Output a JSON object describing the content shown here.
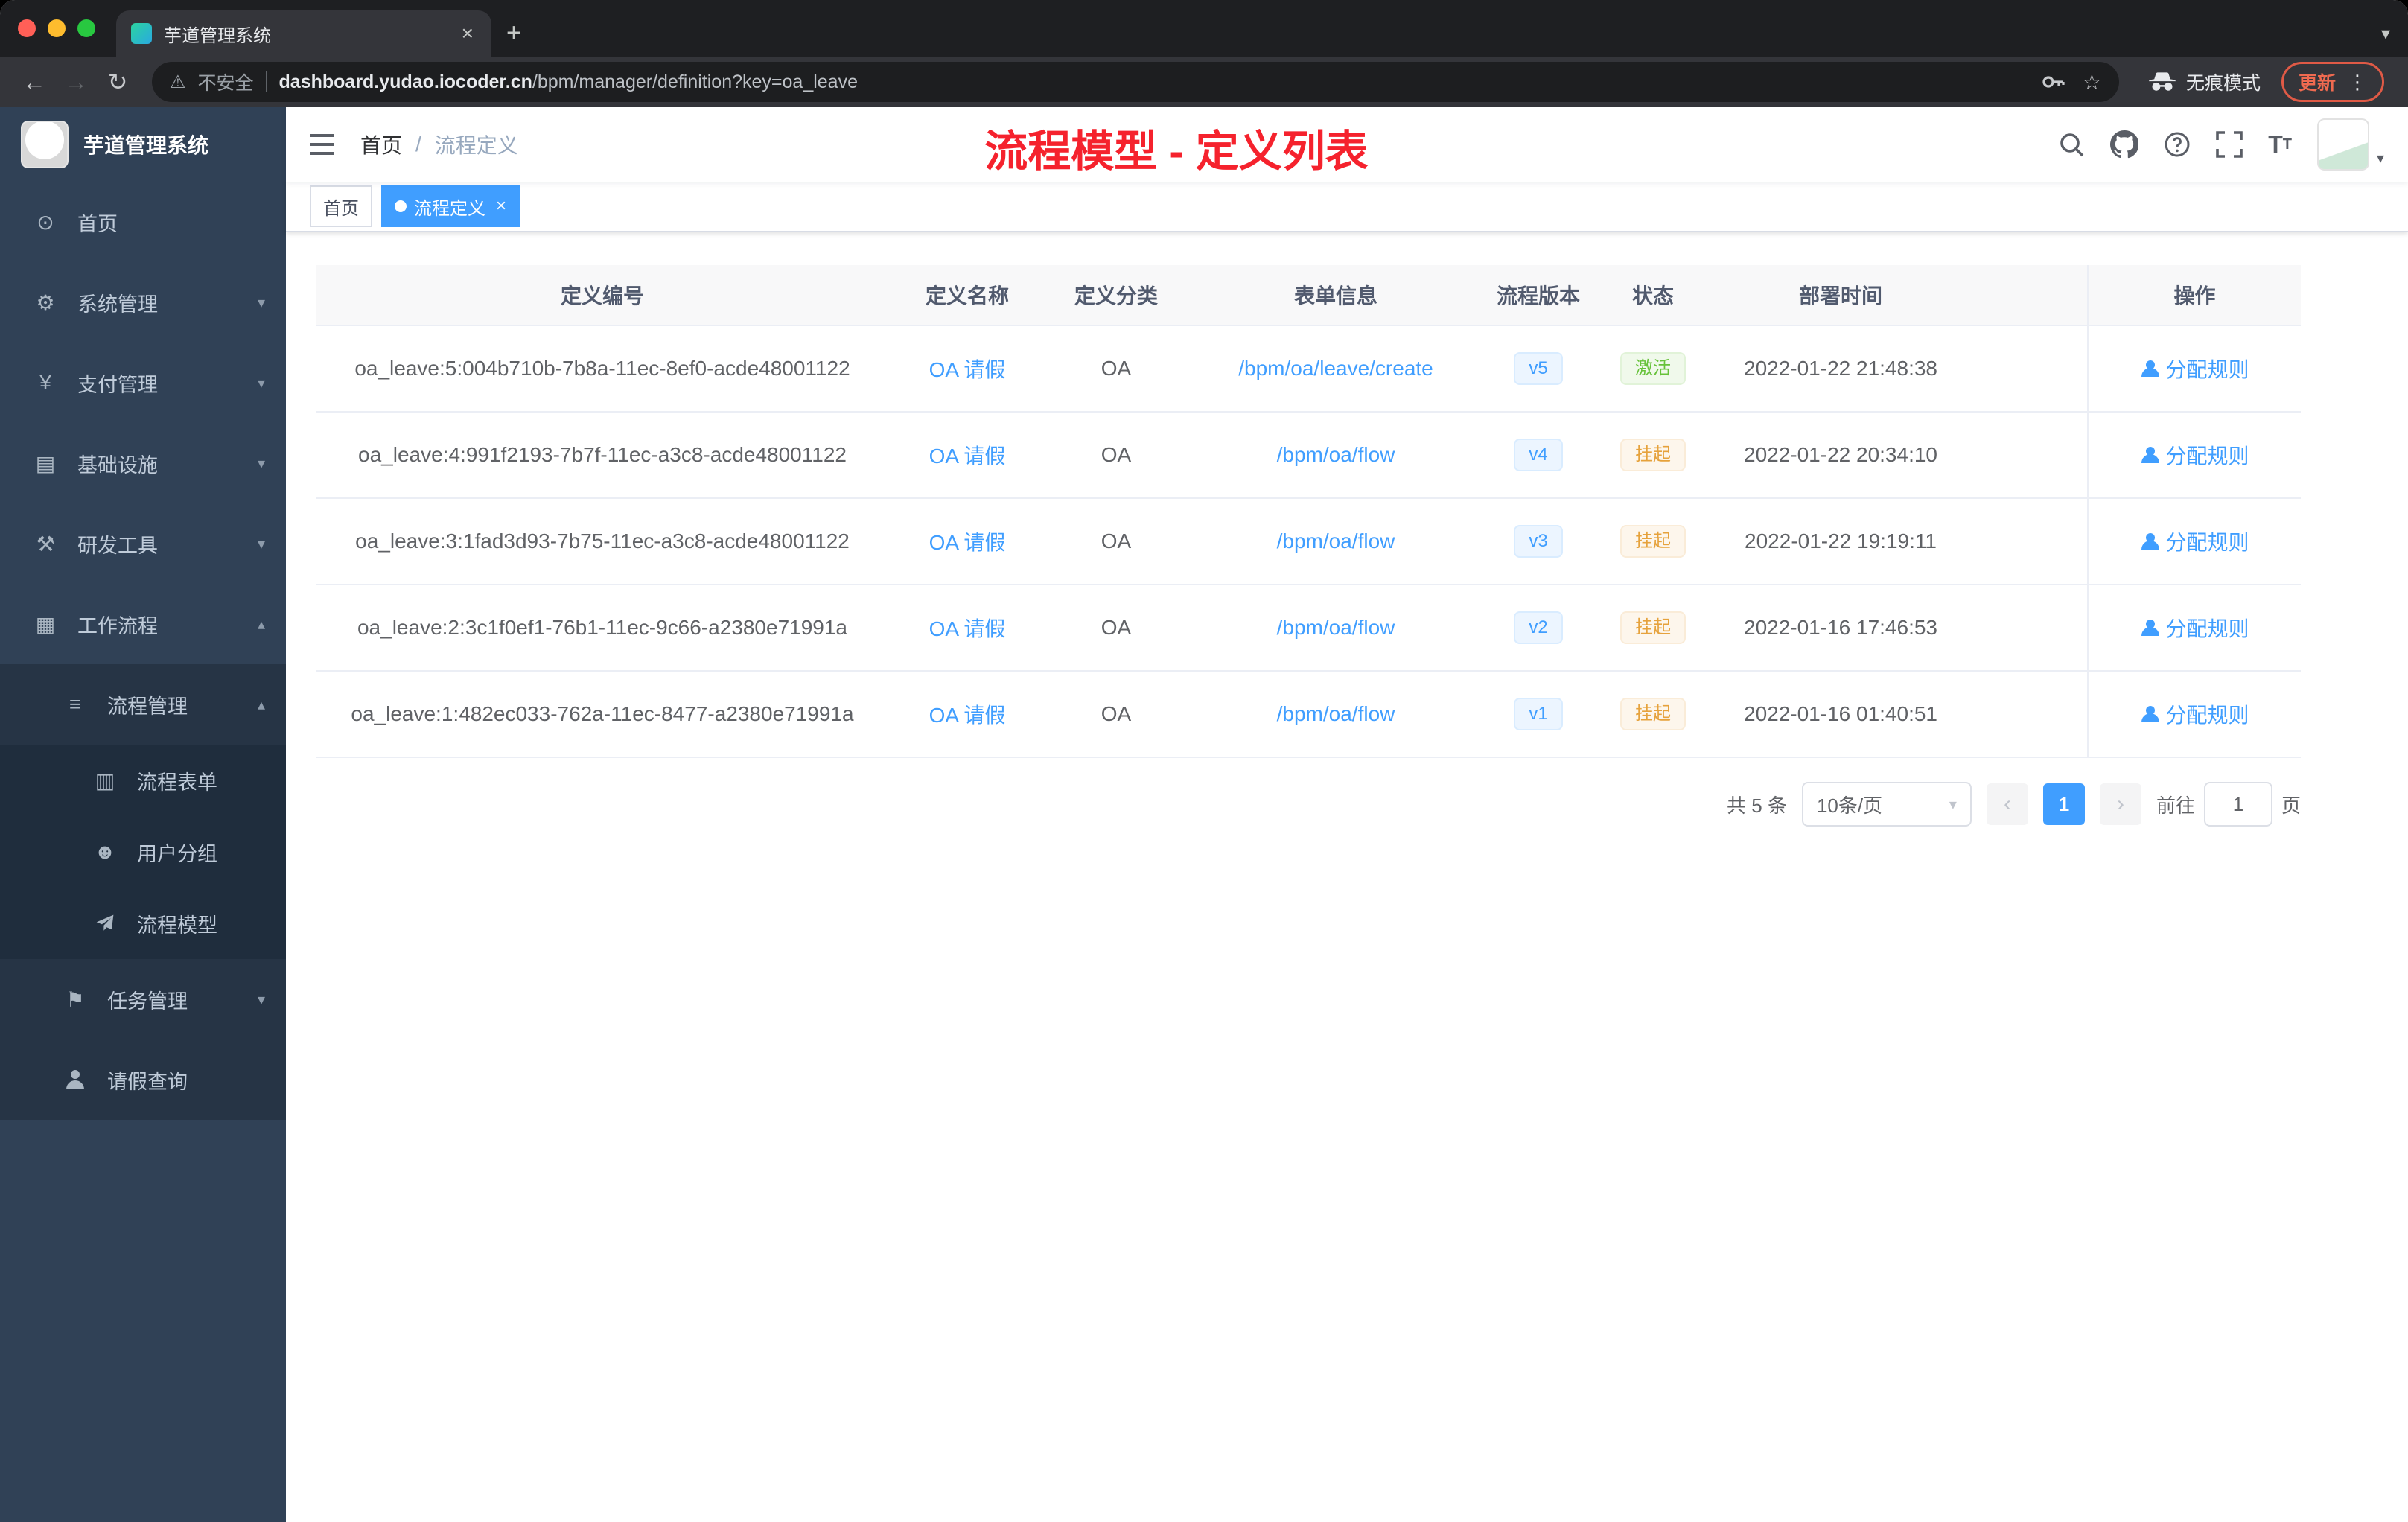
{
  "colors": {
    "accent": "#409eff",
    "success": "#67c23a",
    "warning": "#e6a23c",
    "title-red": "#f5222d",
    "sidebar-bg": "#304156"
  },
  "browser": {
    "tab_title": "芋道管理系统",
    "security_label": "不安全",
    "url_domain": "dashboard.yudao.iocoder.cn",
    "url_path": "/bpm/manager/definition?key=oa_leave",
    "incognito_label": "无痕模式",
    "update_label": "更新"
  },
  "sidebar": {
    "logo_title": "芋道管理系统",
    "items": [
      {
        "label": "首页",
        "icon": "dashboard-icon"
      },
      {
        "label": "系统管理",
        "icon": "gear-icon"
      },
      {
        "label": "支付管理",
        "icon": "yen-icon"
      },
      {
        "label": "基础设施",
        "icon": "infrastructure-icon"
      },
      {
        "label": "研发工具",
        "icon": "tools-icon"
      },
      {
        "label": "工作流程",
        "icon": "workflow-icon"
      },
      {
        "label": "流程管理",
        "icon": "process-manage-icon"
      },
      {
        "label": "流程表单",
        "icon": "form-icon"
      },
      {
        "label": "用户分组",
        "icon": "user-group-icon"
      },
      {
        "label": "流程模型",
        "icon": "model-icon"
      },
      {
        "label": "任务管理",
        "icon": "task-icon"
      },
      {
        "label": "请假查询",
        "icon": "person-icon"
      }
    ]
  },
  "header": {
    "breadcrumb_home": "首页",
    "breadcrumb_current": "流程定义",
    "page_title": "流程模型 - 定义列表"
  },
  "tags": {
    "home": "首页",
    "current": "流程定义"
  },
  "table": {
    "columns": [
      "定义编号",
      "定义名称",
      "定义分类",
      "表单信息",
      "流程版本",
      "状态",
      "部署时间",
      "操作"
    ],
    "rows": [
      {
        "id": "oa_leave:5:004b710b-7b8a-11ec-8ef0-acde48001122",
        "name": "OA 请假",
        "category": "OA",
        "form": "/bpm/oa/leave/create",
        "version": "v5",
        "status": "激活",
        "deploy_time": "2022-01-22 21:48:38",
        "action": "分配规则"
      },
      {
        "id": "oa_leave:4:991f2193-7b7f-11ec-a3c8-acde48001122",
        "name": "OA 请假",
        "category": "OA",
        "form": "/bpm/oa/flow",
        "version": "v4",
        "status": "挂起",
        "deploy_time": "2022-01-22 20:34:10",
        "action": "分配规则"
      },
      {
        "id": "oa_leave:3:1fad3d93-7b75-11ec-a3c8-acde48001122",
        "name": "OA 请假",
        "category": "OA",
        "form": "/bpm/oa/flow",
        "version": "v3",
        "status": "挂起",
        "deploy_time": "2022-01-22 19:19:11",
        "action": "分配规则"
      },
      {
        "id": "oa_leave:2:3c1f0ef1-76b1-11ec-9c66-a2380e71991a",
        "name": "OA 请假",
        "category": "OA",
        "form": "/bpm/oa/flow",
        "version": "v2",
        "status": "挂起",
        "deploy_time": "2022-01-16 17:46:53",
        "action": "分配规则"
      },
      {
        "id": "oa_leave:1:482ec033-762a-11ec-8477-a2380e71991a",
        "name": "OA 请假",
        "category": "OA",
        "form": "/bpm/oa/flow",
        "version": "v1",
        "status": "挂起",
        "deploy_time": "2022-01-16 01:40:51",
        "action": "分配规则"
      }
    ]
  },
  "pagination": {
    "total": "共 5 条",
    "page_size": "10条/页",
    "current_page": "1",
    "goto_label": "前往",
    "goto_value": "1",
    "page_unit": "页"
  }
}
